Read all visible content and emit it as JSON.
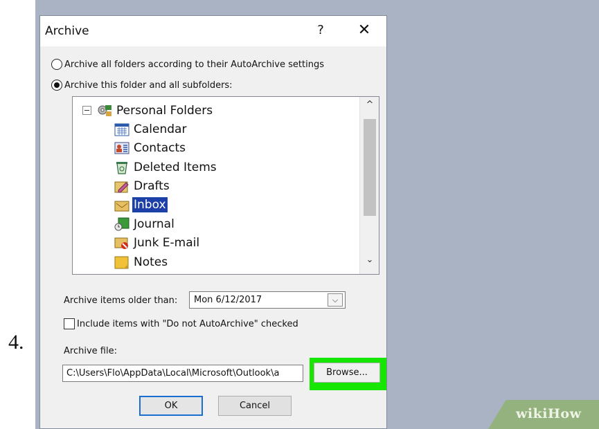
{
  "step_number": "4.",
  "dialog": {
    "title": "Archive",
    "help_label": "?",
    "close_label": "✕"
  },
  "options": {
    "archive_all_label": "Archive all folders according to their AutoArchive settings",
    "archive_all_selected": false,
    "archive_folder_label": "Archive this folder and all subfolders:",
    "archive_folder_selected": true
  },
  "folder_tree": {
    "root": {
      "label": "Personal Folders",
      "icon": "personal-folders-icon"
    },
    "items": [
      {
        "label": "Calendar",
        "icon": "calendar-icon"
      },
      {
        "label": "Contacts",
        "icon": "contacts-icon"
      },
      {
        "label": "Deleted Items",
        "icon": "deleted-items-icon"
      },
      {
        "label": "Drafts",
        "icon": "drafts-icon"
      },
      {
        "label": "Inbox",
        "icon": "inbox-icon",
        "selected": true
      },
      {
        "label": "Journal",
        "icon": "journal-icon"
      },
      {
        "label": "Junk E-mail",
        "icon": "junk-email-icon"
      },
      {
        "label": "Notes",
        "icon": "notes-icon"
      }
    ],
    "scroll_up": "^",
    "scroll_down": "⌄"
  },
  "archive_older": {
    "label": "Archive items older than:",
    "value": "Mon 6/12/2017",
    "arrow": "⌵"
  },
  "include_checkbox": {
    "label": "Include items with \"Do not AutoArchive\" checked",
    "checked": false
  },
  "archive_file": {
    "label": "Archive file:",
    "path": "C:\\Users\\Flo\\AppData\\Local\\Microsoft\\Outlook\\a",
    "browse_label": "Browse..."
  },
  "buttons": {
    "ok_label": "OK",
    "cancel_label": "Cancel"
  },
  "colors": {
    "highlight_green": "#17e700",
    "selection_blue": "#1c3fa8",
    "desktop_blue_gray": "#a9b3c4",
    "wikihow_green": "#94b27e"
  },
  "watermark": "wikiHow"
}
